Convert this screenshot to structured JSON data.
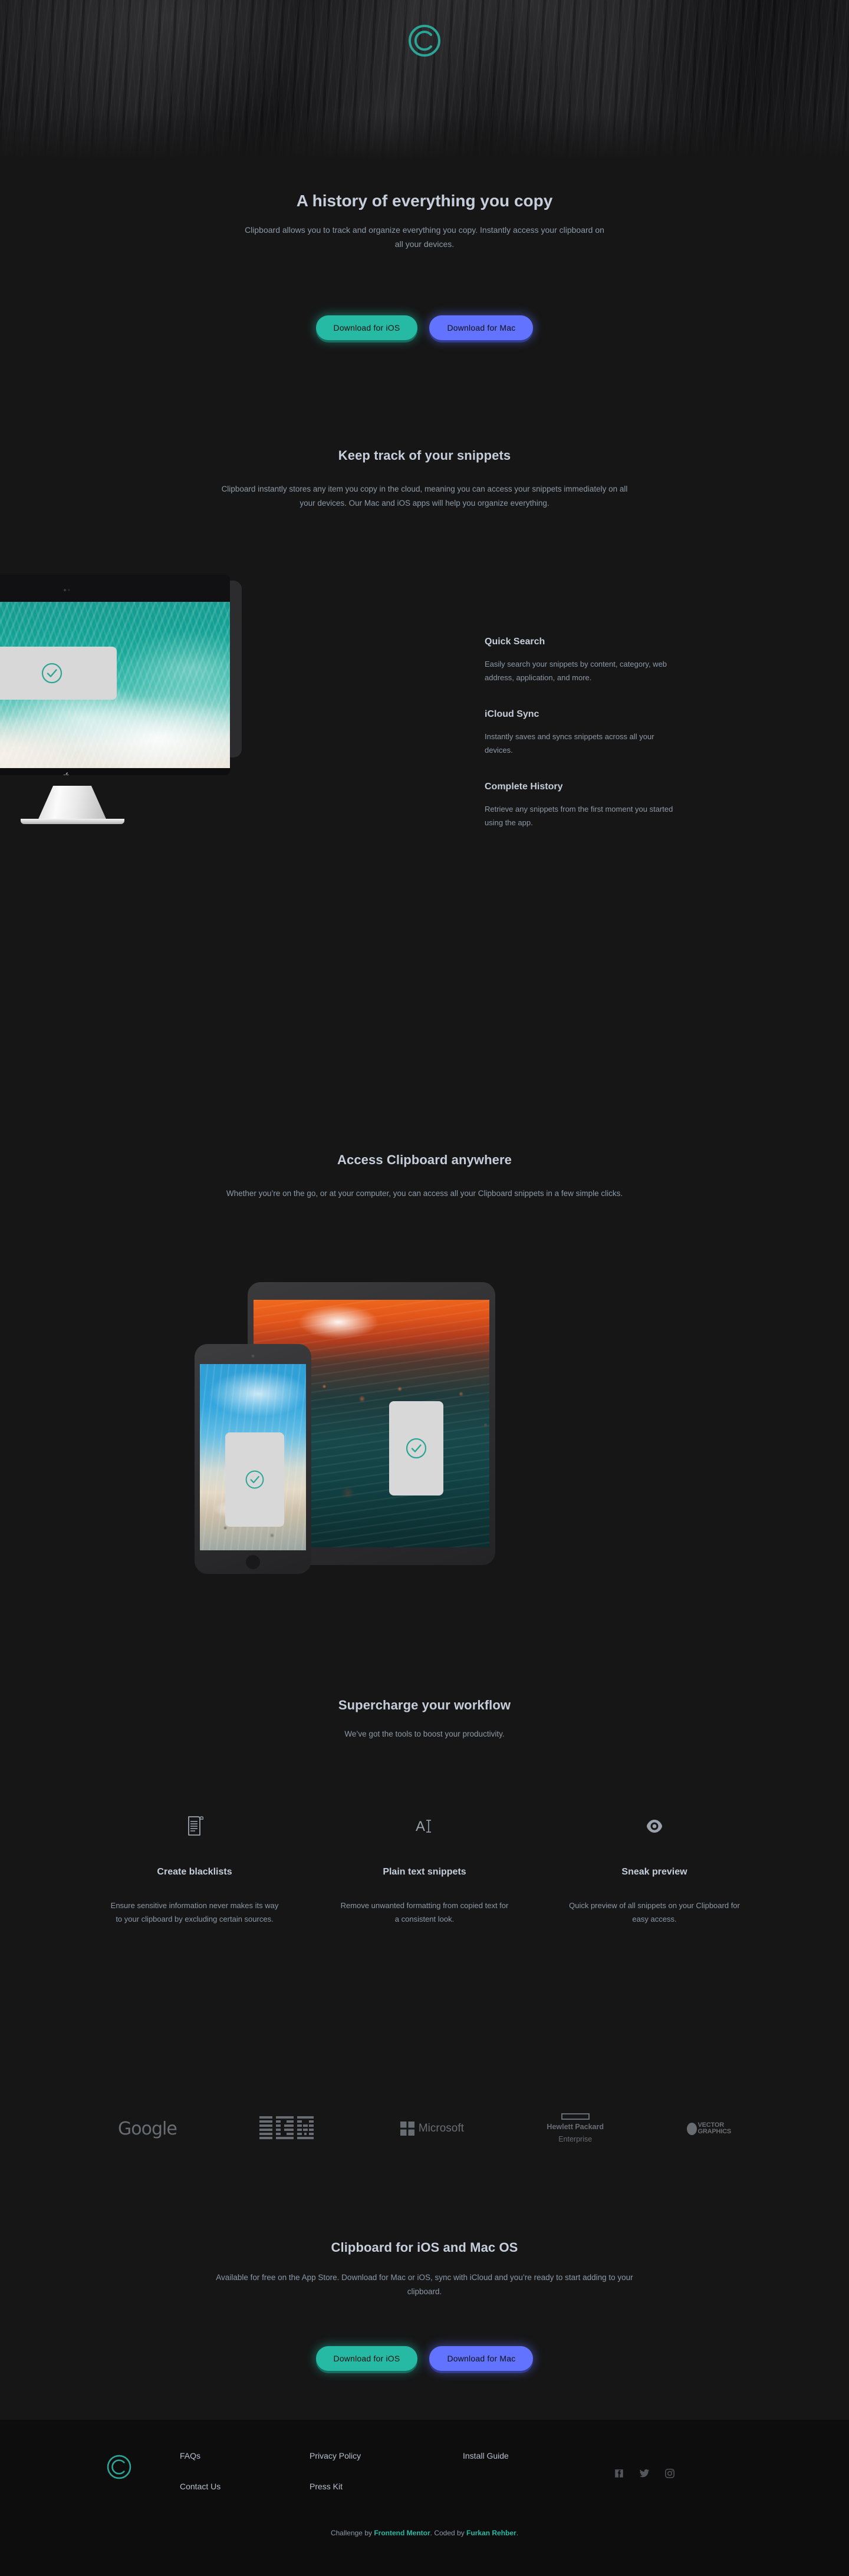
{
  "brand": {
    "accent_teal": "#26BAA4",
    "accent_purple": "#6173FF",
    "logo_icon": "clipboard-c-logo"
  },
  "hero": {
    "heading": "A history of everything you copy",
    "subtext": "Clipboard allows you to track and organize everything you copy. Instantly access your clipboard on all your devices.",
    "cta_ios": "Download for iOS",
    "cta_mac": "Download for Mac"
  },
  "snippets": {
    "title": "Keep track of your snippets",
    "subtext": "Clipboard instantly stores any item you copy in the cloud, meaning you can access your snippets immediately on all your devices. Our Mac and iOS apps will help you organize everything.",
    "features": [
      {
        "title": "Quick Search",
        "body": "Easily search your snippets by content, category, web address, application, and more."
      },
      {
        "title": "iCloud Sync",
        "body": "Instantly saves and syncs snippets across all your devices."
      },
      {
        "title": "Complete History",
        "body": "Retrieve any snippets from the first moment you started using the app."
      }
    ]
  },
  "anywhere": {
    "title": "Access Clipboard anywhere",
    "subtext": "Whether you’re on the go, or at your computer, you can access all your Clipboard snippets in a few simple clicks."
  },
  "workflow": {
    "title": "Supercharge your workflow",
    "subtext": "We’ve got the tools to boost your productivity.",
    "cards": [
      {
        "icon": "blacklist-document-icon",
        "title": "Create blacklists",
        "body": "Ensure sensitive information never makes its way to your clipboard by excluding certain sources."
      },
      {
        "icon": "plain-text-icon",
        "title": "Plain text snippets",
        "body": "Remove unwanted formatting from copied text for a consistent look."
      },
      {
        "icon": "eye-preview-icon",
        "title": "Sneak preview",
        "body": "Quick preview of all snippets on your Clipboard for easy access."
      }
    ]
  },
  "logos": [
    {
      "name": "google-logo",
      "label": "Google"
    },
    {
      "name": "ibm-logo",
      "label": "IBM"
    },
    {
      "name": "microsoft-logo",
      "label": "Microsoft"
    },
    {
      "name": "hewlett-packard-enterprise-logo",
      "label_line1": "Hewlett Packard",
      "label_line2": "Enterprise"
    },
    {
      "name": "vector-graphics-logo",
      "label_line1": "VECTOR",
      "label_line2": "GRAPHICS"
    }
  ],
  "final_cta": {
    "title": "Clipboard for iOS and Mac OS",
    "subtext": "Available for free on the App Store. Download for Mac or iOS, sync with iCloud and you’re ready to start adding to your clipboard.",
    "cta_ios": "Download for iOS",
    "cta_mac": "Download for Mac"
  },
  "footer": {
    "links": [
      "FAQs",
      "Privacy Policy",
      "Install Guide",
      "Contact Us",
      "Press Kit",
      ""
    ],
    "socials": [
      "facebook-icon",
      "twitter-icon",
      "instagram-icon"
    ],
    "attribution": {
      "prefix": "Challenge by ",
      "link1": "Frontend Mentor",
      "middle": ". Coded by ",
      "link2": "Furkan Rehber",
      "suffix": "."
    }
  }
}
